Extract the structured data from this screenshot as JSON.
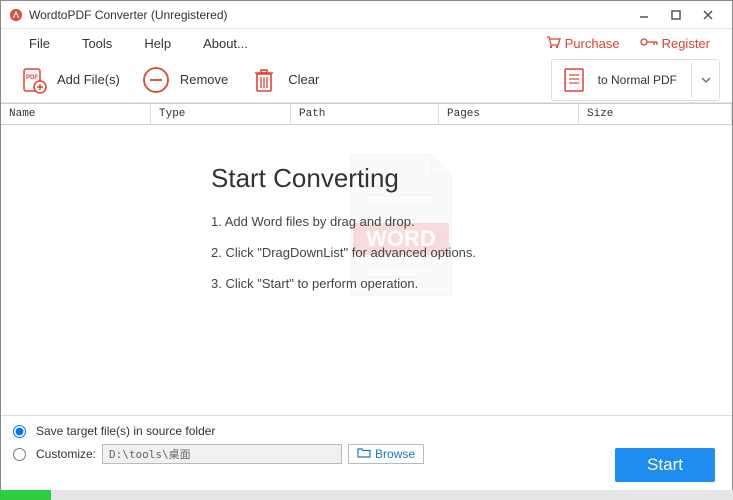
{
  "window": {
    "title": "WordtoPDF Converter (Unregistered)"
  },
  "menu": {
    "file": "File",
    "tools": "Tools",
    "help": "Help",
    "about": "About...",
    "purchase": "Purchase",
    "register": "Register"
  },
  "toolbar": {
    "add": "Add File(s)",
    "remove": "Remove",
    "clear": "Clear",
    "output": "to Normal PDF"
  },
  "columns": {
    "name": "Name",
    "type": "Type",
    "path": "Path",
    "pages": "Pages",
    "size": "Size"
  },
  "content": {
    "heading": "Start Converting",
    "step1": "1. Add Word files by drag and drop.",
    "step2": "2. Click \"DragDownList\" for advanced options.",
    "step3": "3. Click \"Start\" to perform operation.",
    "badge": "WORD"
  },
  "bottom": {
    "opt1": "Save target file(s) in source folder",
    "opt2": "Customize:",
    "path": "D:\\tools\\桌面",
    "browse": "Browse",
    "start": "Start"
  }
}
